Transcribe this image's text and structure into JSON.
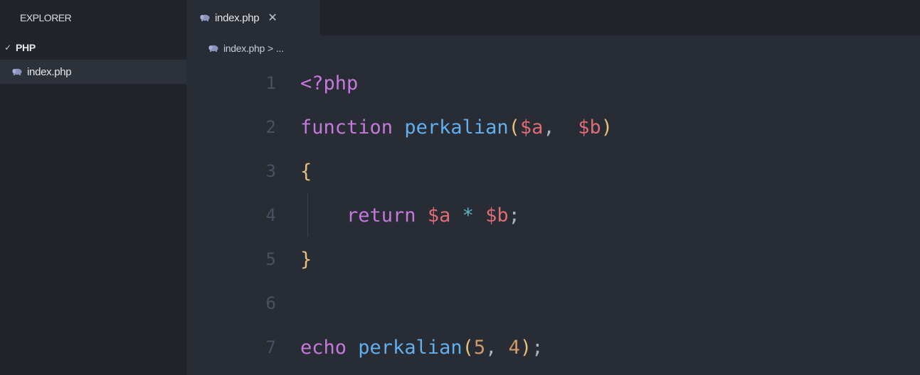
{
  "sidebar": {
    "title": "EXPLORER",
    "folder": {
      "chevron": "✓",
      "name": "PHP"
    },
    "files": [
      {
        "name": "index.php",
        "icon": "php-elephant-icon"
      }
    ]
  },
  "editor": {
    "tabs": [
      {
        "label": "index.php",
        "close": "✕",
        "icon": "php-elephant-icon"
      }
    ],
    "breadcrumb": {
      "file": "index.php",
      "separator": ">",
      "ellipsis": "..."
    },
    "lines": [
      {
        "number": "1",
        "tokens": [
          {
            "t": "<?php",
            "c": "kw"
          }
        ]
      },
      {
        "number": "2",
        "tokens": [
          {
            "t": "function",
            "c": "kw"
          },
          {
            "t": " ",
            "c": "punct"
          },
          {
            "t": "perkalian",
            "c": "fn"
          },
          {
            "t": "(",
            "c": "paren"
          },
          {
            "t": "$a",
            "c": "var"
          },
          {
            "t": ",  ",
            "c": "punct"
          },
          {
            "t": "$b",
            "c": "var"
          },
          {
            "t": ")",
            "c": "paren"
          }
        ]
      },
      {
        "number": "3",
        "tokens": [
          {
            "t": "{",
            "c": "brace"
          }
        ]
      },
      {
        "number": "4",
        "indent": true,
        "tokens": [
          {
            "t": "    ",
            "c": "punct"
          },
          {
            "t": "return",
            "c": "kw"
          },
          {
            "t": " ",
            "c": "punct"
          },
          {
            "t": "$a",
            "c": "var"
          },
          {
            "t": " ",
            "c": "punct"
          },
          {
            "t": "*",
            "c": "op"
          },
          {
            "t": " ",
            "c": "punct"
          },
          {
            "t": "$b",
            "c": "var"
          },
          {
            "t": ";",
            "c": "punct"
          }
        ]
      },
      {
        "number": "5",
        "tokens": [
          {
            "t": "}",
            "c": "brace"
          }
        ]
      },
      {
        "number": "6",
        "tokens": []
      },
      {
        "number": "7",
        "tokens": [
          {
            "t": "echo",
            "c": "kw"
          },
          {
            "t": " ",
            "c": "punct"
          },
          {
            "t": "perkalian",
            "c": "fn"
          },
          {
            "t": "(",
            "c": "paren"
          },
          {
            "t": "5",
            "c": "num"
          },
          {
            "t": ", ",
            "c": "punct"
          },
          {
            "t": "4",
            "c": "num"
          },
          {
            "t": ")",
            "c": "paren"
          },
          {
            "t": ";",
            "c": "punct"
          }
        ]
      }
    ]
  },
  "colors": {
    "sidebar_bg": "#21252b",
    "editor_bg": "#282c34",
    "selected_file_bg": "#2c313a",
    "keyword": "#c678dd",
    "function": "#61afef",
    "variable": "#e06c75",
    "bracket": "#e5c07b",
    "number": "#d19a66",
    "operator": "#56b6c2",
    "line_number": "#495162"
  }
}
